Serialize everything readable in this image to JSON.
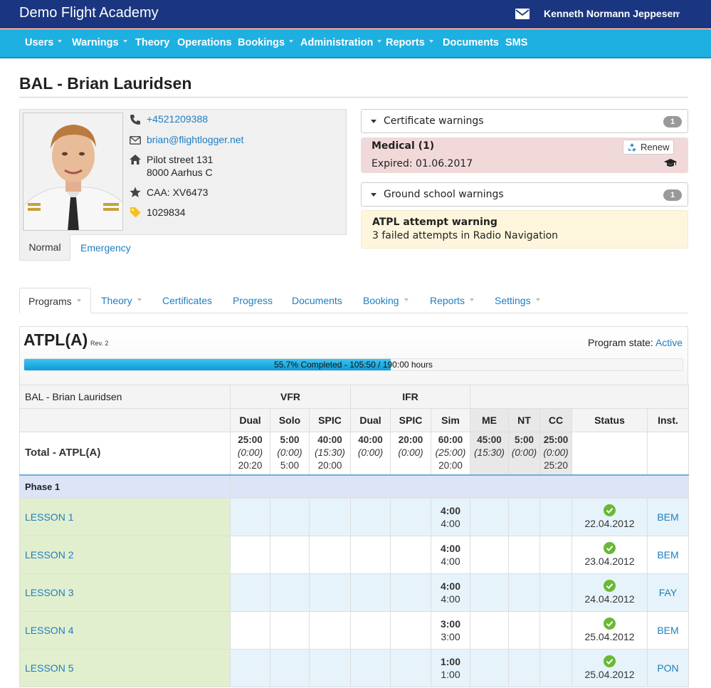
{
  "app": {
    "brand": "Demo Flight Academy",
    "user_name": "Kenneth Normann Jeppesen"
  },
  "nav": [
    {
      "label": "Users",
      "dropdown": true
    },
    {
      "label": "Warnings",
      "dropdown": true
    },
    {
      "label": "Theory",
      "dropdown": false
    },
    {
      "label": "Operations",
      "dropdown": false
    },
    {
      "label": "Bookings",
      "dropdown": true
    },
    {
      "label": "Administration",
      "dropdown": true
    },
    {
      "label": "Reports",
      "dropdown": true
    },
    {
      "label": "Documents",
      "dropdown": false
    },
    {
      "label": "SMS",
      "dropdown": false
    }
  ],
  "page_title": "BAL - Brian Lauridsen",
  "profile": {
    "phone": "+4521209388",
    "email": "brian@flightlogger.net",
    "address_line1": "Pilot street 131",
    "address_line2": "8000 Aarhus C",
    "caa": "CAA: XV6473",
    "tag": "1029834",
    "tabs": [
      "Normal",
      "Emergency"
    ]
  },
  "certificate_warnings": {
    "header": "Certificate warnings",
    "count": "1",
    "title": "Medical (1)",
    "subtitle": "Expired: 01.06.2017",
    "renew_label": "Renew"
  },
  "ground_school_warnings": {
    "header": "Ground school warnings",
    "count": "1",
    "title": "ATPL attempt warning",
    "subtitle": "3 failed attempts in Radio Navigation"
  },
  "tabs": [
    {
      "label": "Programs",
      "dropdown": true
    },
    {
      "label": "Theory",
      "dropdown": true
    },
    {
      "label": "Certificates",
      "dropdown": false
    },
    {
      "label": "Progress",
      "dropdown": false
    },
    {
      "label": "Documents",
      "dropdown": false
    },
    {
      "label": "Booking",
      "dropdown": true
    },
    {
      "label": "Reports",
      "dropdown": true
    },
    {
      "label": "Settings",
      "dropdown": true
    }
  ],
  "program": {
    "title": "ATPL(A)",
    "revision": "Rev. 2",
    "state_label": "Program state:",
    "state_value": "Active",
    "progress_percent": 55.7,
    "progress_text": "55.7% Completed - 105:50 / 190:00 hours"
  },
  "table": {
    "student": "BAL - Brian Lauridsen",
    "groups": [
      "VFR",
      "IFR"
    ],
    "columns": [
      "Dual",
      "Solo",
      "SPIC",
      "Dual",
      "SPIC",
      "Sim",
      "ME",
      "NT",
      "CC",
      "Status",
      "Inst."
    ],
    "total": {
      "label": "Total - ATPL(A)",
      "cells": [
        {
          "req": "25:00",
          "planned": "(0:00)",
          "done": "20:20"
        },
        {
          "req": "5:00",
          "planned": "(0:00)",
          "done": "5:00"
        },
        {
          "req": "40:00",
          "planned": "(15:30)",
          "done": "20:00"
        },
        {
          "req": "40:00",
          "planned": "(0:00)",
          "done": ""
        },
        {
          "req": "20:00",
          "planned": "(0:00)",
          "done": ""
        },
        {
          "req": "60:00",
          "planned": "(25:00)",
          "done": "20:00"
        },
        {
          "req": "45:00",
          "planned": "(15:30)",
          "done": ""
        },
        {
          "req": "5:00",
          "planned": "(0:00)",
          "done": ""
        },
        {
          "req": "25:00",
          "planned": "(0:00)",
          "done": "25:20"
        }
      ]
    },
    "phase": "Phase 1",
    "lessons": [
      {
        "name": "LESSON 1",
        "sim_req": "4:00",
        "sim_done": "4:00",
        "date": "22.04.2012",
        "inst": "BEM"
      },
      {
        "name": "LESSON 2",
        "sim_req": "4:00",
        "sim_done": "4:00",
        "date": "23.04.2012",
        "inst": "BEM"
      },
      {
        "name": "LESSON 3",
        "sim_req": "4:00",
        "sim_done": "4:00",
        "date": "24.04.2012",
        "inst": "FAY"
      },
      {
        "name": "LESSON 4",
        "sim_req": "3:00",
        "sim_done": "3:00",
        "date": "25.04.2012",
        "inst": "BEM"
      },
      {
        "name": "LESSON 5",
        "sim_req": "1:00",
        "sim_done": "1:00",
        "date": "25.04.2012",
        "inst": "PON"
      }
    ]
  },
  "colors": {
    "topbar": "#1b3680",
    "navbar": "#1eb0e0",
    "link": "#1e7ec2",
    "cert_warning_bg": "#f2d9d9",
    "ground_warning_bg": "#fdf6dd",
    "lesson_name_bg": "#e2efce",
    "phase_bg": "#dde4f7",
    "status_ok": "#6ab836"
  }
}
